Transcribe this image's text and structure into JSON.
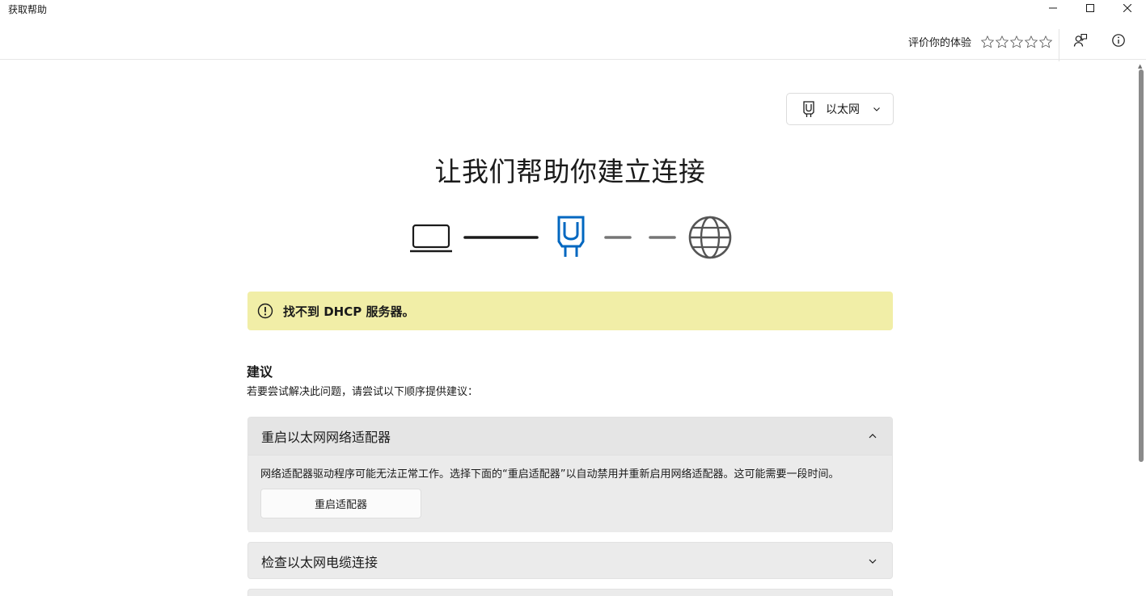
{
  "window": {
    "title": "获取帮助",
    "controls": [
      "minimize-icon",
      "maximize-icon",
      "close-icon"
    ]
  },
  "toolbar": {
    "rate_label": "评价你的体验",
    "stars": 5,
    "icons": [
      "feedback-icon",
      "info-icon"
    ]
  },
  "network_selector": {
    "icon": "ethernet-icon",
    "selected": "以太网"
  },
  "main": {
    "title": "让我们帮助你建立连接",
    "diagram": [
      "laptop-icon",
      "ethernet-icon",
      "globe-icon"
    ],
    "accent": "#0067c0"
  },
  "banner": {
    "icon": "warning-icon",
    "message": "找不到 DHCP 服务器。",
    "color": "#f1eea7"
  },
  "suggestions": {
    "title": "建议",
    "subtitle": "若要尝试解决此问题，请尝试以下顺序提供建议：",
    "items": [
      {
        "title": "重启以太网网络适配器",
        "expanded": true,
        "description": "网络适配器驱动程序可能无法正常工作。选择下面的“重启适配器”以自动禁用并重新启用网络适配器。这可能需要一段时间。",
        "button": "重启适配器"
      },
      {
        "title": "检查以太网电缆连接",
        "expanded": false
      }
    ]
  }
}
